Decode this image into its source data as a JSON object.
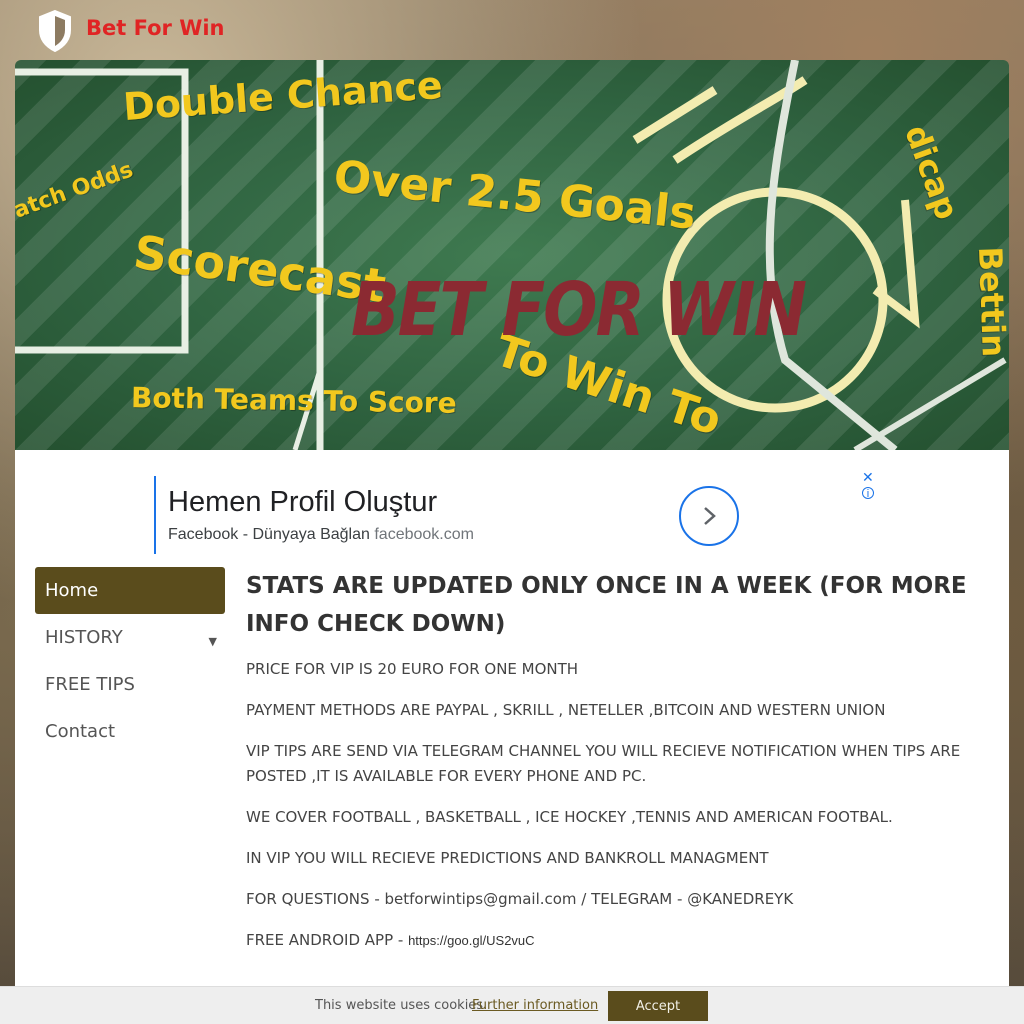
{
  "header": {
    "site_title": "Bet For Win",
    "logo_icon": "shield-icon"
  },
  "banner": {
    "brand_text": "BET FOR WIN",
    "chalk_words": {
      "double_chance": "Double Chance",
      "match_odds": "atch Odds",
      "over_goals": "Over 2.5 Goals",
      "scorecast": "Scorecast",
      "to_win": "To Win To",
      "btts": "Both Teams To Score",
      "handicap": "dicap",
      "betting": "Bettin"
    }
  },
  "ad": {
    "title": "Hemen Profil Oluştur",
    "subtitle": "Facebook - Dünyaya Bağlan",
    "domain": "facebook.com",
    "close_icon": "close-icon",
    "info_icon": "info-icon",
    "arrow_icon": "chevron-right-icon"
  },
  "nav": {
    "items": [
      {
        "label": "Home",
        "active": true
      },
      {
        "label": "HISTORY",
        "has_submenu": true
      },
      {
        "label": "FREE TIPS"
      },
      {
        "label": "Contact"
      }
    ],
    "caret": "▼"
  },
  "main": {
    "title": "STATS ARE UPDATED ONLY ONCE IN A WEEK (FOR MORE INFO CHECK DOWN)",
    "paragraphs": [
      "PRICE FOR VIP IS 20 EURO FOR ONE MONTH",
      "PAYMENT METHODS ARE PAYPAL , SKRILL , NETELLER ,BITCOIN AND WESTERN UNION",
      "VIP TIPS ARE SEND VIA TELEGRAM CHANNEL YOU WILL RECIEVE NOTIFICATION WHEN TIPS ARE POSTED ,IT IS AVAILABLE FOR EVERY PHONE AND PC.",
      "WE COVER FOOTBALL , BASKETBALL , ICE HOCKEY ,TENNIS AND AMERICAN FOOTBAL.",
      "IN VIP YOU WILL RECIEVE PREDICTIONS AND BANKROLL MANAGMENT",
      "FOR QUESTIONS - betforwintips@gmail.com / TELEGRAM - @KANEDREYK"
    ],
    "app_label": "FREE ANDROID APP - ",
    "app_link": "https://goo.gl/US2vuC"
  },
  "cookie": {
    "text": "This website uses cookies.",
    "link": "Further information",
    "accept": "Accept"
  },
  "colors": {
    "brand_red": "#e02424",
    "nav_active": "#5a4c1c",
    "ad_blue": "#1a73e8",
    "chalk_yellow": "#f2c81e"
  }
}
